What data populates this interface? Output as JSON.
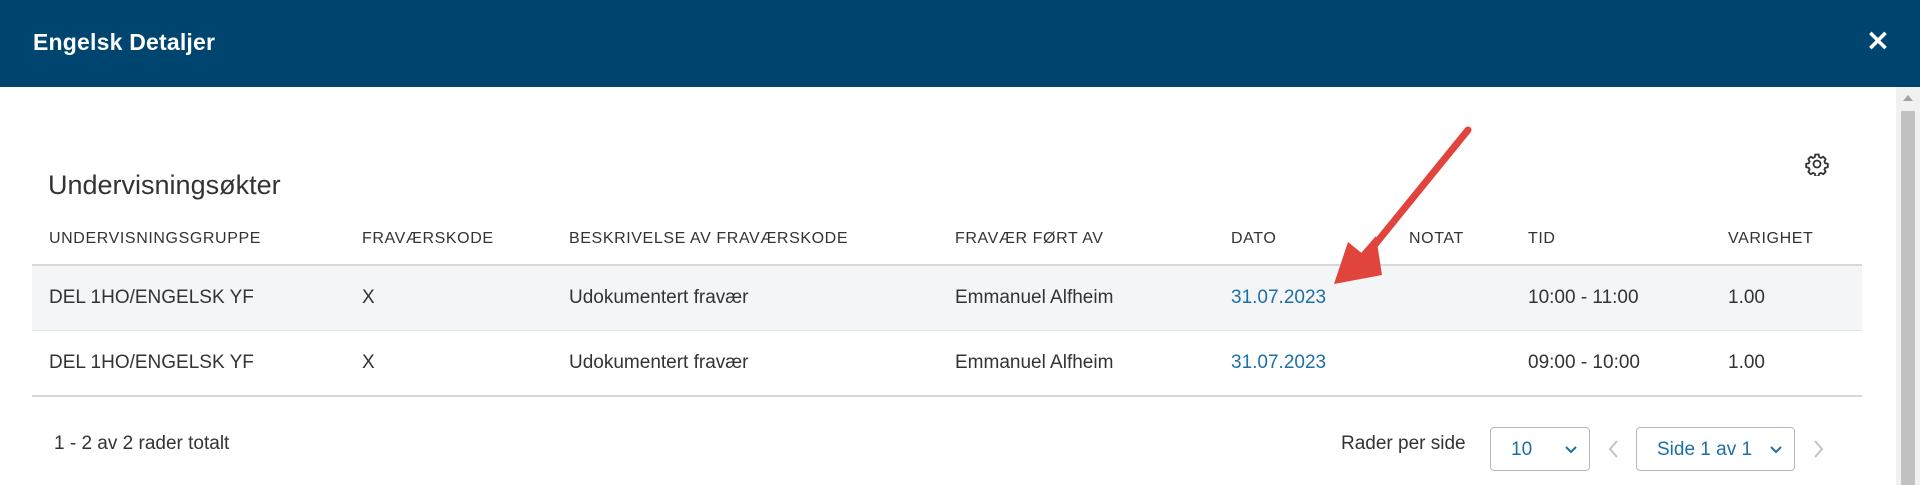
{
  "dialog": {
    "title": "Engelsk Detaljer",
    "close_glyph": "×"
  },
  "section": {
    "title": "Undervisningsøkter",
    "settings_icon": "gear-icon"
  },
  "table": {
    "columns": [
      "UNDERVISNINGSGRUPPE",
      "FRAVÆRSKODE",
      "BESKRIVELSE AV FRAVÆRSKODE",
      "FRAVÆR FØRT AV",
      "DATO",
      "NOTAT",
      "TID",
      "VARIGHET"
    ],
    "rows": [
      [
        "DEL 1HO/ENGELSK YF",
        "X",
        "Udokumentert fravær",
        "Emmanuel Alfheim",
        "31.07.2023",
        "",
        "10:00 - 11:00",
        "1.00"
      ],
      [
        "DEL 1HO/ENGELSK YF",
        "X",
        "Udokumentert fravær",
        "Emmanuel Alfheim",
        "31.07.2023",
        "",
        "09:00 - 10:00",
        "1.00"
      ]
    ]
  },
  "footer": {
    "count_text": "1 - 2 av 2 rader totalt",
    "rows_per_page_label": "Rader per side",
    "rows_per_page_value": "10",
    "page_value": "Side 1 av 1"
  },
  "colors": {
    "header_bg": "#004470",
    "link": "#1d6fa8",
    "annotation_arrow": "#e0443c",
    "row_highlight": "#f4f5f6"
  }
}
